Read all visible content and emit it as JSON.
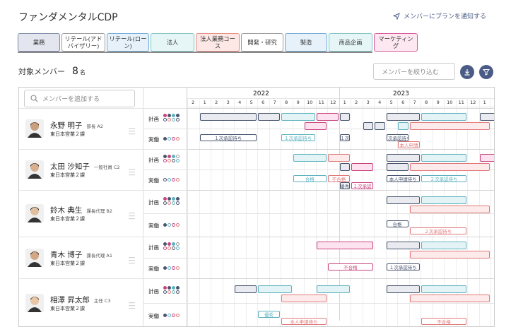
{
  "header": {
    "title": "ファンダメンタルCDP",
    "notify_label": "メンバーにプランを通知する"
  },
  "tabs": [
    {
      "label": "業務",
      "bg": "#e3e6ee",
      "border": "#7c8aa8"
    },
    {
      "label": "リテール(アドバイザリー)",
      "bg": "#ffffff",
      "border": "#999999"
    },
    {
      "label": "リテール(ローン)",
      "bg": "#e6f1fa",
      "border": "#6fa9d6"
    },
    {
      "label": "法人",
      "bg": "#e6f6f6",
      "border": "#7cc4c4"
    },
    {
      "label": "法人業務コース",
      "bg": "#fde8e6",
      "border": "#e58a82"
    },
    {
      "label": "開発・研究",
      "bg": "#ffffff",
      "border": "#999999"
    },
    {
      "label": "製造",
      "bg": "#e6f1fa",
      "border": "#6fa9d6"
    },
    {
      "label": "商品企画",
      "bg": "#e6f6f6",
      "border": "#7cc4c4"
    },
    {
      "label": "マーケティング",
      "bg": "#fde8f2",
      "border": "#d9559a"
    }
  ],
  "members": {
    "label": "対象メンバー",
    "count": "8",
    "unit": "名"
  },
  "filter": {
    "placeholder": "メンバーを絞り込む"
  },
  "search": {
    "placeholder": "メンバーを追加する"
  },
  "row_labels": {
    "plan": "計画",
    "actual": "実働"
  },
  "timeline": {
    "years": [
      {
        "label": "2022",
        "month_index": 6
      },
      {
        "label": "2023",
        "month_index": 18
      }
    ],
    "months": [
      "2",
      "1",
      "2",
      "3",
      "4",
      "5",
      "6",
      "7",
      "8",
      "9",
      "10",
      "11",
      "12",
      "1",
      "2",
      "3",
      "4",
      "5",
      "6",
      "7",
      "8",
      "9",
      "10",
      "11",
      "12",
      "1",
      "2"
    ]
  },
  "people": [
    {
      "name": "永野 明子",
      "role": "部長 A2",
      "dept": "東日本営業２課",
      "plan": [
        {
          "s": 1,
          "e": 6,
          "c": "gray"
        },
        {
          "s": 6,
          "e": 8,
          "c": "gray"
        },
        {
          "s": 8,
          "e": 11,
          "c": "teal"
        },
        {
          "s": 11,
          "e": 13,
          "c": "pink"
        },
        {
          "s": 13,
          "e": 14,
          "c": "gray"
        },
        {
          "s": 17,
          "e": 20,
          "c": "gray"
        },
        {
          "s": 20,
          "e": 24,
          "c": "teal"
        },
        {
          "s": 25,
          "e": 27,
          "c": "gray"
        },
        {
          "s": 10,
          "e": 12,
          "c": "pink",
          "r": 2
        },
        {
          "s": 15,
          "e": 16,
          "c": "gray",
          "r": 2
        },
        {
          "s": 16,
          "e": 17,
          "c": "gray",
          "r": 2
        },
        {
          "s": 18,
          "e": 19,
          "c": "teal",
          "r": 2
        },
        {
          "s": 19,
          "e": 26,
          "c": "red",
          "r": 2
        }
      ],
      "actual": [
        {
          "s": 1,
          "e": 6,
          "c": "gray",
          "t": "１次承認待ち"
        },
        {
          "s": 8,
          "e": 11,
          "c": "teal",
          "t": "１次承認待ち"
        },
        {
          "s": 13,
          "e": 14,
          "c": "gray",
          "t": "１次"
        },
        {
          "s": 17,
          "e": 19,
          "c": "gray",
          "t": "１次承認待ち"
        },
        {
          "s": 18,
          "e": 20,
          "c": "red",
          "t": "本人申請",
          "r": 2
        }
      ]
    },
    {
      "name": "太田 沙知子",
      "role": "一般社員 C2",
      "dept": "東日本営業２課",
      "plan": [
        {
          "s": 9,
          "e": 12,
          "c": "teal"
        },
        {
          "s": 12,
          "e": 14,
          "c": "red"
        },
        {
          "s": 17,
          "e": 20,
          "c": "gray"
        },
        {
          "s": 20,
          "e": 24,
          "c": "teal"
        },
        {
          "s": 25,
          "e": 27,
          "c": "pink"
        },
        {
          "s": 13,
          "e": 14,
          "c": "gray",
          "r": 2
        },
        {
          "s": 14,
          "e": 16,
          "c": "pink",
          "r": 2
        },
        {
          "s": 17,
          "e": 19,
          "c": "gray",
          "r": 2
        },
        {
          "s": 19,
          "e": 26,
          "c": "red",
          "r": 2
        }
      ],
      "actual": [
        {
          "s": 9,
          "e": 12,
          "c": "teal",
          "t": "合格"
        },
        {
          "s": 12,
          "e": 14,
          "c": "red",
          "t": "不合格"
        },
        {
          "s": 17,
          "e": 20,
          "c": "gray",
          "t": "本人申請待ち"
        },
        {
          "s": 20,
          "e": 24,
          "c": "teal",
          "t": "２次承認待ち"
        },
        {
          "s": 13,
          "e": 14,
          "c": "gray",
          "t": "優秀",
          "r": 2
        },
        {
          "s": 14,
          "e": 16,
          "c": "pink",
          "t": "１次承認",
          "r": 2
        }
      ]
    },
    {
      "name": "鈴木 典生",
      "role": "課長代理 B2",
      "dept": "東日本営業２課",
      "plan": [
        {
          "s": 17,
          "e": 20,
          "c": "gray"
        },
        {
          "s": 20,
          "e": 24,
          "c": "teal"
        },
        {
          "s": 19,
          "e": 26,
          "c": "red",
          "r": 2
        }
      ],
      "actual": [
        {
          "s": 17,
          "e": 19,
          "c": "gray",
          "t": "合格"
        },
        {
          "s": 19,
          "e": 24,
          "c": "red",
          "t": "２次承認待ち",
          "r": 2
        }
      ]
    },
    {
      "name": "青木 博子",
      "role": "課長代理 A1",
      "dept": "東日本営業２課",
      "plan": [
        {
          "s": 11,
          "e": 16,
          "c": "pink"
        },
        {
          "s": 17,
          "e": 20,
          "c": "gray"
        },
        {
          "s": 20,
          "e": 24,
          "c": "teal"
        },
        {
          "s": 19,
          "e": 26,
          "c": "red",
          "r": 2
        }
      ],
      "actual": [
        {
          "s": 12,
          "e": 16,
          "c": "pink",
          "t": "不合格"
        },
        {
          "s": 17,
          "e": 20,
          "c": "gray",
          "t": "１次承認待ち"
        }
      ]
    },
    {
      "name": "相澤 昇太郎",
      "role": "主任 C3",
      "dept": "東日本営業２課",
      "plan": [
        {
          "s": 4,
          "e": 6,
          "c": "gray"
        },
        {
          "s": 6,
          "e": 9,
          "c": "teal"
        },
        {
          "s": 11,
          "e": 14,
          "c": "teal"
        },
        {
          "s": 17,
          "e": 20,
          "c": "gray"
        },
        {
          "s": 20,
          "e": 24,
          "c": "teal"
        },
        {
          "s": 8,
          "e": 12,
          "c": "red",
          "r": 2
        },
        {
          "s": 19,
          "e": 26,
          "c": "red",
          "r": 2
        }
      ],
      "actual": [
        {
          "s": 6,
          "e": 8,
          "c": "teal",
          "t": "優秀"
        },
        {
          "s": 8,
          "e": 12,
          "c": "red",
          "t": "本人申請待ち",
          "r": 2
        },
        {
          "s": 20,
          "e": 24,
          "c": "red",
          "t": "不合格",
          "r": 2
        }
      ]
    }
  ],
  "colors": {
    "gray": {
      "bg": "#e9ebf0",
      "bd": "#4a5670"
    },
    "teal": {
      "bg": "#e4f4f6",
      "bd": "#5fb3c0"
    },
    "pink": {
      "bg": "#fde3ef",
      "bd": "#c9457f"
    },
    "red": {
      "bg": "#fdeaea",
      "bd": "#e0797b"
    },
    "accent": "#4a5c86"
  }
}
